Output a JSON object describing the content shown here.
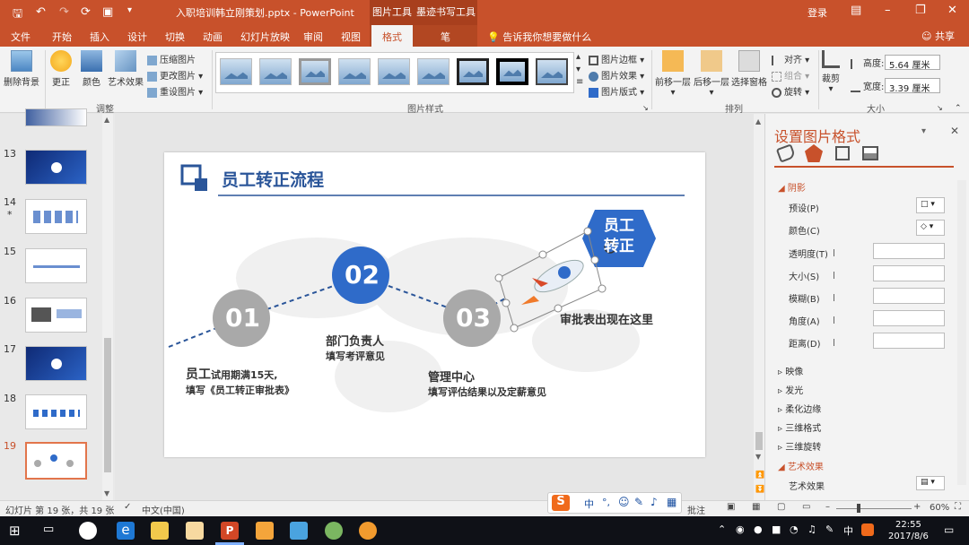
{
  "titlebar": {
    "doc_title": "入职培训韩立刚策划.pptx  -  PowerPoint",
    "ctx_tab_1": "图片工具",
    "ctx_tab_2": "墨迹书写工具",
    "login": "登录"
  },
  "tabs": [
    "文件",
    "开始",
    "插入",
    "设计",
    "切换",
    "动画",
    "幻灯片放映",
    "审阅",
    "视图",
    "格式",
    "笔"
  ],
  "tell_me": "告诉我你想要做什么",
  "share": "共享",
  "ribbon": {
    "remove_bg": "删除背景",
    "corrections": "更正",
    "color": "颜色",
    "artistic": "艺术效果",
    "compress": "压缩图片",
    "change": "更改图片",
    "reset": "重设图片",
    "group_adjust": "调整",
    "group_styles": "图片样式",
    "border": "图片边框",
    "effects": "图片效果",
    "layout": "图片版式",
    "forward": "前移一层",
    "backward": "后移一层",
    "selection_pane": "选择窗格",
    "align": "对齐",
    "group_obj": "组合",
    "rotate": "旋转",
    "group_arrange": "排列",
    "crop": "裁剪",
    "height_label": "高度:",
    "height_value": "5.64 厘米",
    "width_label": "宽度:",
    "width_value": "3.39 厘米",
    "group_size": "大小"
  },
  "slides": [
    {
      "num": "13",
      "star": ""
    },
    {
      "num": "14",
      "star": "*"
    },
    {
      "num": "15",
      "star": ""
    },
    {
      "num": "16",
      "star": ""
    },
    {
      "num": "17",
      "star": ""
    },
    {
      "num": "18",
      "star": ""
    },
    {
      "num": "19",
      "star": ""
    }
  ],
  "slide": {
    "title": "员工转正流程",
    "step1_num": "01",
    "step1_bold": "员工",
    "step1_line1": "试用期满15天,",
    "step1_line2": "填写《员工转正审批表》",
    "step2_num": "02",
    "step2_title": "部门负责人",
    "step2_desc": "填写考评意见",
    "step3_num": "03",
    "step3_title": "管理中心",
    "step3_desc": "填写评估结果以及定薪意见",
    "hex_line1": "员工",
    "hex_line2": "转正",
    "approval": "审批表出现在这里",
    "colors": {
      "accent": "#2f6bc9",
      "gray": "#a9a9a9"
    }
  },
  "pane": {
    "title": "设置图片格式",
    "section_shadow": "阴影",
    "preset": "预设(P)",
    "color": "颜色(C)",
    "transparency": "透明度(T)",
    "size": "大小(S)",
    "blur": "模糊(B)",
    "angle": "角度(A)",
    "distance": "距离(D)",
    "reflection": "映像",
    "glow": "发光",
    "soft_edges": "柔化边缘",
    "format_3d": "三维格式",
    "rotation_3d": "三维旋转",
    "art_section": "艺术效果",
    "art_effect": "艺术效果"
  },
  "status": {
    "slide_info": "幻灯片 第 19 张，共 19 张",
    "language": "中文(中国)",
    "comments": "批注",
    "zoom": "60%",
    "ime": "中"
  },
  "taskbar": {
    "ime": "中",
    "time": "22:55",
    "date": "2017/8/6"
  }
}
